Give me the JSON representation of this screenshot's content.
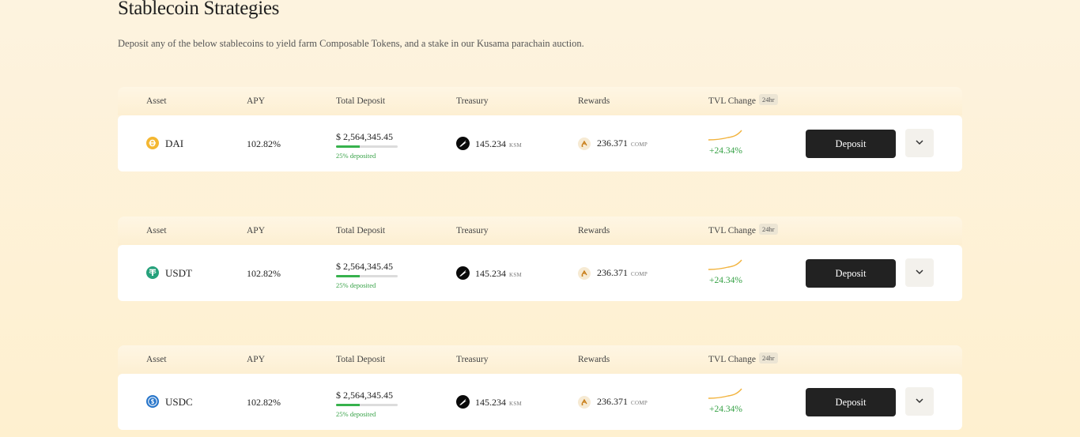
{
  "page": {
    "title": "Stablecoin Strategies",
    "subtitle": "Deposit any of the below stablecoins to yield farm Composable Tokens, and a stake in our Kusama parachain auction."
  },
  "columns": {
    "asset": "Asset",
    "apy": "APY",
    "total_deposit": "Total Deposit",
    "treasury": "Treasury",
    "rewards": "Rewards",
    "tvl_change": "TVL Change",
    "tvl_badge": "24hr"
  },
  "colors": {
    "dai": "#f4b731",
    "usdt": "#26a17b",
    "usdc": "#2775ca",
    "positive": "#37a247",
    "button": "#222222"
  },
  "strategies": [
    {
      "asset": "DAI",
      "icon": "dai-icon",
      "apy": "102.82%",
      "total_deposit": "$ 2,564,345.45",
      "deposited_pct": 0.38,
      "deposited_label": "25% deposited",
      "treasury_value": "145.234",
      "treasury_unit": "KSM",
      "reward_value": "236.371",
      "reward_unit": "COMP",
      "tvl_change": "+24.34%",
      "deposit_label": "Deposit"
    },
    {
      "asset": "USDT",
      "icon": "usdt-icon",
      "apy": "102.82%",
      "total_deposit": "$ 2,564,345.45",
      "deposited_pct": 0.38,
      "deposited_label": "25% deposited",
      "treasury_value": "145.234",
      "treasury_unit": "KSM",
      "reward_value": "236.371",
      "reward_unit": "COMP",
      "tvl_change": "+24.34%",
      "deposit_label": "Deposit"
    },
    {
      "asset": "USDC",
      "icon": "usdc-icon",
      "apy": "102.82%",
      "total_deposit": "$ 2,564,345.45",
      "deposited_pct": 0.38,
      "deposited_label": "25% deposited",
      "treasury_value": "145.234",
      "treasury_unit": "KSM",
      "reward_value": "236.371",
      "reward_unit": "COMP",
      "tvl_change": "+24.34%",
      "deposit_label": "Deposit"
    }
  ]
}
